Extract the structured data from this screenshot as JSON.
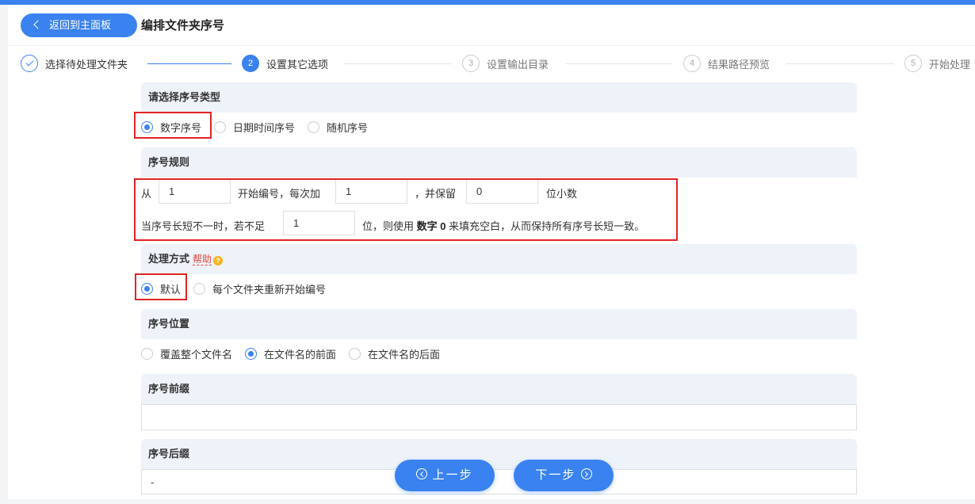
{
  "header": {
    "back_label": "返回到主面板",
    "title": "编排文件夹序号"
  },
  "steps": [
    {
      "num": "1",
      "label": "选择待处理文件夹",
      "state": "done"
    },
    {
      "num": "2",
      "label": "设置其它选项",
      "state": "active"
    },
    {
      "num": "3",
      "label": "设置输出目录",
      "state": "todo"
    },
    {
      "num": "4",
      "label": "结果路径预览",
      "state": "todo"
    },
    {
      "num": "5",
      "label": "开始处理",
      "state": "todo"
    }
  ],
  "seq_type": {
    "title": "请选择序号类型",
    "options": [
      "数字序号",
      "日期时间序号",
      "随机序号"
    ],
    "selected": "数字序号"
  },
  "seq_rule": {
    "title": "序号规则",
    "from_label": "从",
    "start_value": "1",
    "start_suffix": "开始编号，每次加",
    "step_value": "1",
    "keep_label": "，并保留",
    "decimals_value": "0",
    "decimals_suffix": "位小数",
    "pad_prefix": "当序号长短不一时，若不足",
    "pad_value": "1",
    "pad_mid": "位，则使用",
    "pad_char": "数字 0",
    "pad_suffix": "来填充空白，从而保持所有序号长短一致。"
  },
  "process_mode": {
    "title": "处理方式",
    "help_label": "帮助",
    "help_icon": "?",
    "options": [
      "默认",
      "每个文件夹重新开始编号"
    ],
    "selected": "默认"
  },
  "seq_position": {
    "title": "序号位置",
    "options": [
      "覆盖整个文件名",
      "在文件名的前面",
      "在文件名的后面"
    ],
    "selected": "在文件名的前面"
  },
  "prefix": {
    "title": "序号前缀",
    "value": ""
  },
  "suffix": {
    "title": "序号后缀",
    "value": "-"
  },
  "nav": {
    "prev_label": "上一步",
    "next_label": "下一步"
  },
  "colors": {
    "accent": "#3a82f0",
    "highlight": "#e02424",
    "section_bg": "#eef2f9"
  }
}
